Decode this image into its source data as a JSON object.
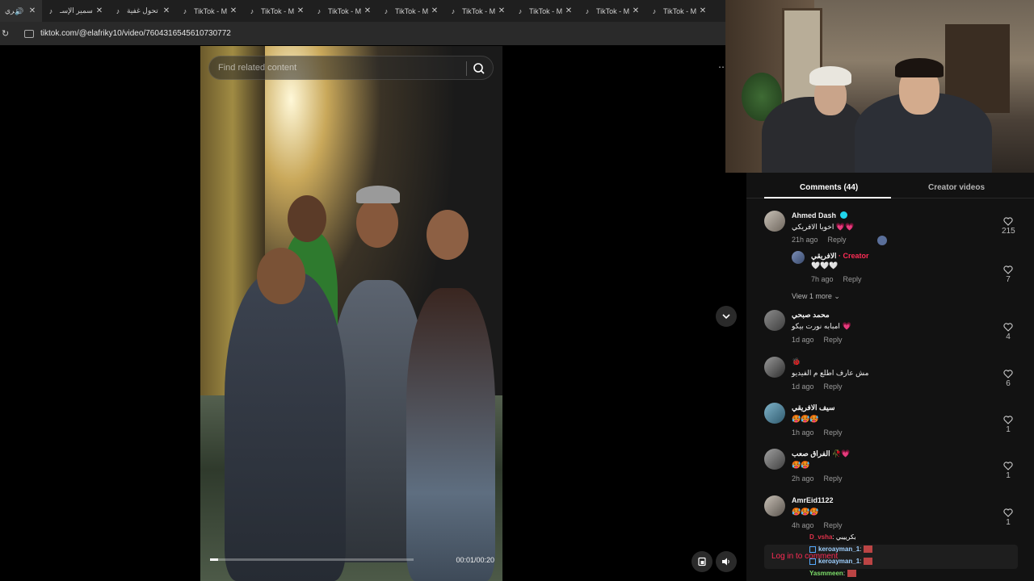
{
  "browser": {
    "tabs": [
      {
        "title": "الافري",
        "active": true
      },
      {
        "title": "سمير الإسـ"
      },
      {
        "title": "تحول غفية"
      },
      {
        "title": "TikTok - M"
      },
      {
        "title": "TikTok - M"
      },
      {
        "title": "TikTok - M"
      },
      {
        "title": "TikTok - M"
      },
      {
        "title": "TikTok - M"
      },
      {
        "title": "TikTok - M"
      },
      {
        "title": "TikTok - M"
      },
      {
        "title": "TikTok - M"
      }
    ],
    "url": "tiktok.com/@elafriky10/video/7604316545610730772"
  },
  "video": {
    "search_placeholder": "Find related content",
    "time": "00:01/00:20",
    "progress": 0.04
  },
  "comments_panel": {
    "tab_comments": "Comments (44)",
    "tab_creator": "Creator videos",
    "comments": [
      {
        "user": "Ahmed Dash",
        "verified": true,
        "text": "اخويا الافريكي 💗💗",
        "time": "21h ago",
        "reply": "Reply",
        "likes": "215"
      },
      {
        "user": "الافريقي",
        "creator_label": "· Creator",
        "text": "🤍🤍🤍",
        "time": "7h ago",
        "reply": "Reply",
        "likes": "7"
      },
      {
        "user": "محمد صبحي",
        "text": "امبابه نورت بيكو 💗",
        "time": "1d ago",
        "reply": "Reply",
        "likes": "4"
      },
      {
        "user": "🐞",
        "text": "مش عارف اطلع م الفيديو",
        "time": "1d ago",
        "reply": "Reply",
        "likes": "6"
      },
      {
        "user": "سيف الافريقي",
        "text": "🥵🥵🥵",
        "time": "1h ago",
        "reply": "Reply",
        "likes": "1"
      },
      {
        "user": "الفراق صعب 🥀💗",
        "text": "🥵🥵",
        "time": "2h ago",
        "reply": "Reply",
        "likes": "1"
      },
      {
        "user": "AmrEid1122",
        "text": "🥵🥵🥵",
        "time": "4h ago",
        "reply": "Reply",
        "likes": "1"
      }
    ],
    "view_more": "View 1 more",
    "login": "Log in to comment"
  },
  "stream_chat": [
    {
      "name": "D_vsha",
      "msg": ": بكرييبي",
      "color": "#e0324a"
    },
    {
      "name": "keroayman_1",
      "msg": ":",
      "color": "#9fd0ff"
    },
    {
      "name": "keroayman_1",
      "msg": ":",
      "color": "#9fd0ff"
    },
    {
      "name": "Yasmmeen",
      "msg": ":",
      "color": "#7dde6a"
    }
  ],
  "colors": {
    "accent": "#fe2c55",
    "verified": "#20d5ec"
  }
}
